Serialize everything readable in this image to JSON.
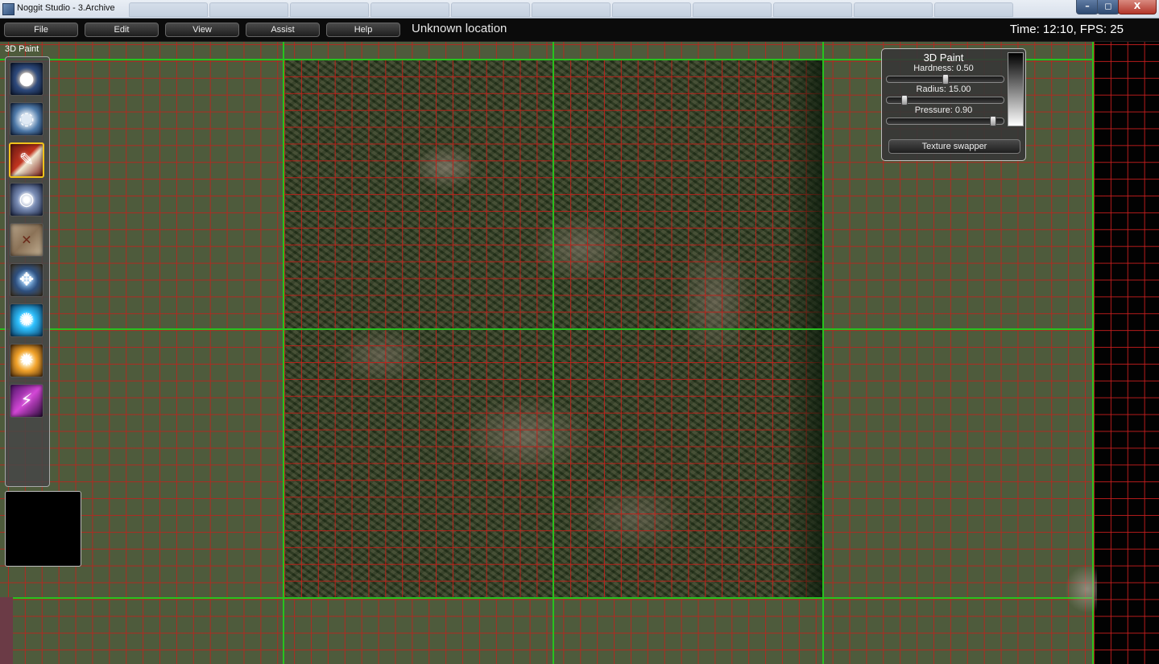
{
  "window": {
    "title": "Noggit Studio - 3.Archive",
    "controls": {
      "minimize": "–",
      "maximize": "◻",
      "close": "X"
    }
  },
  "menu": {
    "items": [
      {
        "label": "File"
      },
      {
        "label": "Edit"
      },
      {
        "label": "View"
      },
      {
        "label": "Assist"
      },
      {
        "label": "Help"
      }
    ],
    "location": "Unknown location",
    "stats": "Time: 12:10, FPS: 25"
  },
  "toolbar": {
    "label": "3D Paint",
    "tools": [
      {
        "icon": "raise-lower-icon"
      },
      {
        "icon": "flatten-blur-icon"
      },
      {
        "icon": "texture-paint-icon",
        "selected": true
      },
      {
        "icon": "holes-icon"
      },
      {
        "icon": "area-id-icon"
      },
      {
        "icon": "impassible-flag-icon"
      },
      {
        "icon": "water-icon"
      },
      {
        "icon": "object-editor-icon"
      },
      {
        "icon": "mccv-painter-icon"
      }
    ]
  },
  "paint_panel": {
    "title": "3D Paint",
    "hardness": {
      "label": "Hardness: 0.50",
      "value": 0.5
    },
    "radius": {
      "label": "Radius: 15.00",
      "value": 15.0,
      "max": 100
    },
    "pressure": {
      "label": "Pressure: 0.90",
      "value": 0.9
    },
    "texture_swapper_label": "Texture swapper"
  },
  "colors": {
    "grid_red": "#c81e19",
    "adt_border_green": "#27c21e",
    "selected_tool_border": "#f1c21b"
  }
}
